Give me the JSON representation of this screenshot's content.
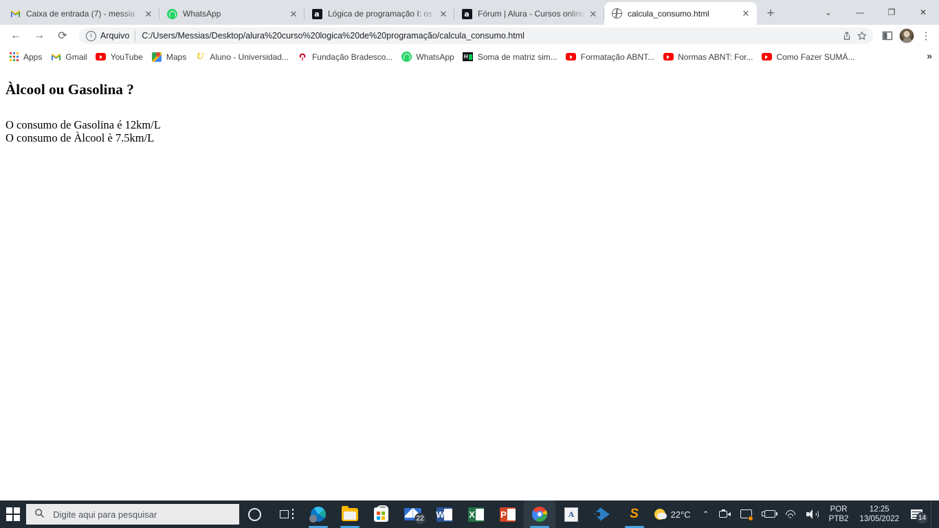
{
  "browser": {
    "tabs": [
      {
        "title": "Caixa de entrada (7) - messia",
        "favicon": "gmail-icon",
        "active": false
      },
      {
        "title": "WhatsApp",
        "favicon": "whatsapp-icon",
        "active": false
      },
      {
        "title": "Lógica de programação I: os",
        "favicon": "alura-icon",
        "active": false
      },
      {
        "title": "Fórum | Alura - Cursos online",
        "favicon": "alura-icon",
        "active": false
      },
      {
        "title": "calcula_consumo.html",
        "favicon": "globe-icon",
        "active": true
      }
    ],
    "tab_close_label": "✕",
    "new_tab_label": "+",
    "window_controls": {
      "search_tabs": "⌄",
      "minimize": "—",
      "maximize": "❐",
      "close": "✕"
    },
    "toolbar": {
      "back": "←",
      "forward": "→",
      "reload": "⟳",
      "info_icon": "ⓘ",
      "scheme_label": "Arquivo",
      "url": "C:/Users/Messias/Desktop/alura%20curso%20logica%20de%20programação/calcula_consumo.html",
      "share_icon": "share-icon",
      "bookmark_icon": "star-icon",
      "sidepanel_icon": "reading-list-icon",
      "avatar": "profile-avatar",
      "menu_icon": "⋮"
    },
    "bookmarks": [
      {
        "label": "Apps",
        "icon": "apps-grid-icon"
      },
      {
        "label": "Gmail",
        "icon": "gmail-icon"
      },
      {
        "label": "YouTube",
        "icon": "youtube-icon"
      },
      {
        "label": "Maps",
        "icon": "maps-icon"
      },
      {
        "label": "Aluno - Universidad...",
        "icon": "aluno-icon"
      },
      {
        "label": "Fundação Bradesco...",
        "icon": "bradesco-icon"
      },
      {
        "label": "WhatsApp",
        "icon": "whatsapp-icon"
      },
      {
        "label": "Soma de matriz sim...",
        "icon": "matrix-icon"
      },
      {
        "label": "Formatação ABNT...",
        "icon": "youtube-icon"
      },
      {
        "label": "Normas ABNT: For...",
        "icon": "youtube-icon"
      },
      {
        "label": "Como Fazer SUMÁ...",
        "icon": "youtube-icon"
      }
    ],
    "bookmarks_overflow": "»"
  },
  "page": {
    "heading": "Àlcool ou Gasolina ?",
    "line1": "O consumo de Gasolina é 12km/L",
    "line2": "O consumo de Àlcool è 7.5km/L"
  },
  "taskbar": {
    "start_label": "start-button",
    "search_placeholder": "Digite aqui para pesquisar",
    "search_icon": "magnifier-icon",
    "items": [
      {
        "name": "cortana-icon"
      },
      {
        "name": "task-view-icon"
      },
      {
        "name": "microsoft-edge-icon"
      },
      {
        "name": "file-explorer-icon"
      },
      {
        "name": "microsoft-store-icon"
      },
      {
        "name": "mail-icon",
        "badge": "22"
      },
      {
        "name": "word-icon",
        "letter": "W"
      },
      {
        "name": "excel-icon",
        "letter": "X"
      },
      {
        "name": "powerpoint-icon",
        "letter": "P"
      },
      {
        "name": "google-chrome-icon"
      },
      {
        "name": "document-app-icon"
      },
      {
        "name": "vs-code-icon"
      },
      {
        "name": "sublime-text-icon"
      }
    ],
    "tray": {
      "weather_temp": "22°C",
      "weather_icon": "sun-cloud-icon",
      "overflow_chevron": "⌃",
      "camera_icon": "camera-icon",
      "screen_share_icon": "screen-share-icon",
      "battery_icon": "battery-charging-icon",
      "wifi_icon": "wifi-icon",
      "volume_icon": "speaker-icon",
      "lang_line1": "POR",
      "lang_line2": "PTB2",
      "time": "12:25",
      "date": "13/05/2022",
      "notification_icon": "action-center-icon",
      "notification_count": "14"
    }
  }
}
